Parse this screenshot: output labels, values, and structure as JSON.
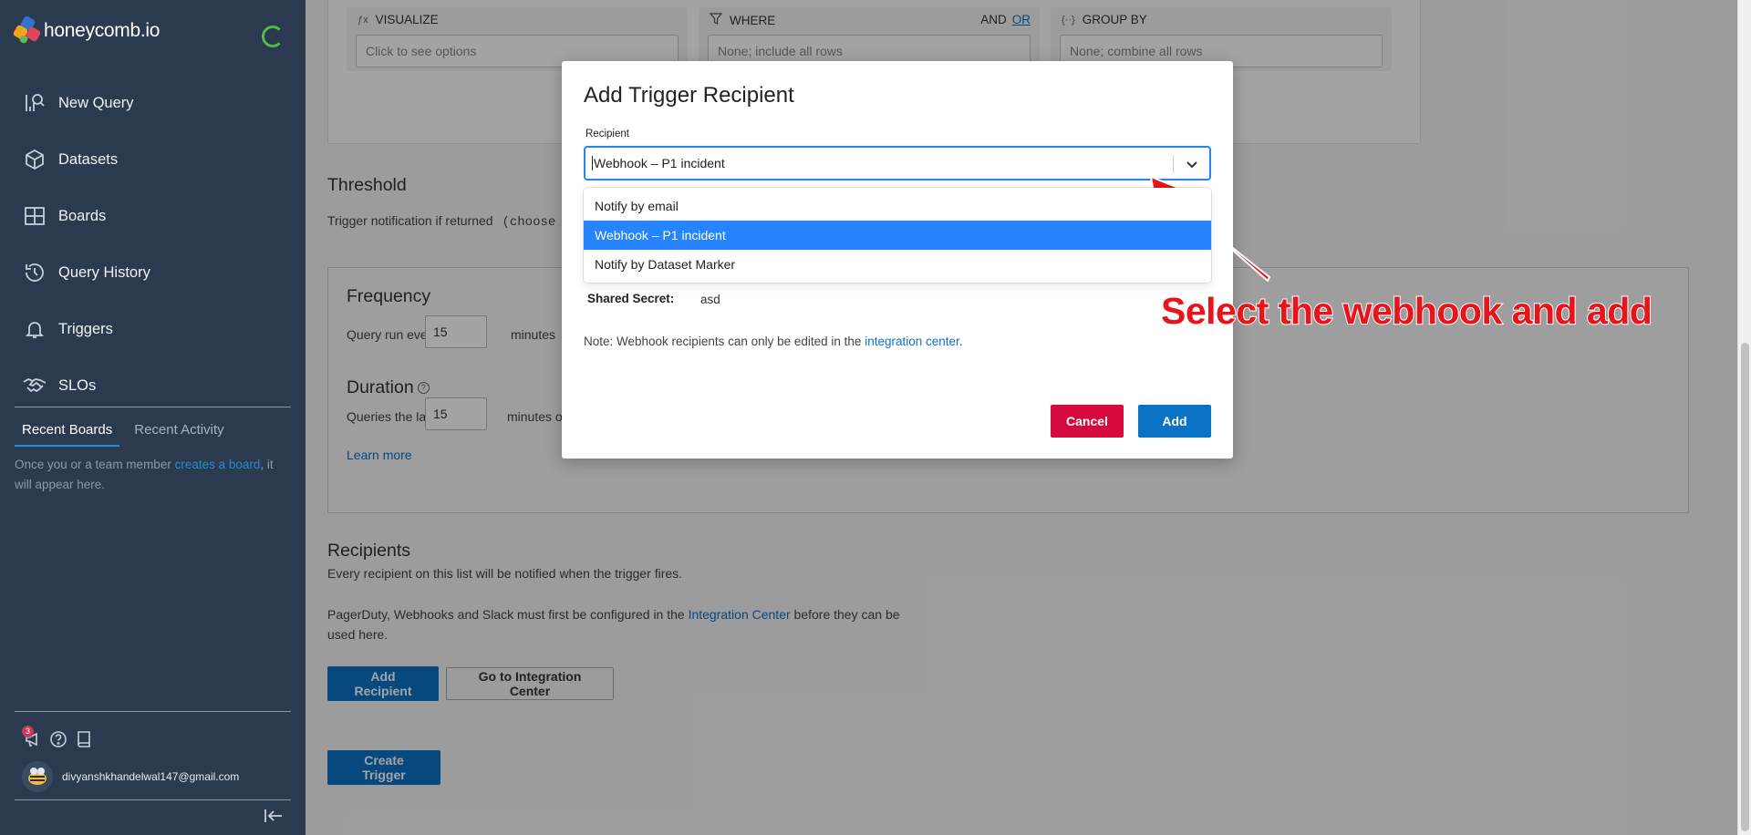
{
  "app": {
    "logo_text": "honeycomb.io"
  },
  "sidebar": {
    "items": [
      {
        "label": "New Query",
        "icon": "new-query-icon"
      },
      {
        "label": "Datasets",
        "icon": "cube-icon"
      },
      {
        "label": "Boards",
        "icon": "boards-icon"
      },
      {
        "label": "Query History",
        "icon": "history-icon"
      },
      {
        "label": "Triggers",
        "icon": "bell-icon"
      },
      {
        "label": "SLOs",
        "icon": "handshake-icon"
      }
    ],
    "tabs": [
      "Recent Boards",
      "Recent Activity"
    ],
    "empty_text_before": "Once you or a team member ",
    "empty_link": "creates a board",
    "empty_text_after": ", it will appear here.",
    "notification_count": "3",
    "user_email": "divyanshkhandelwal147@gmail.com"
  },
  "query": {
    "visualize": {
      "label": "VISUALIZE",
      "placeholder": "Click to see options"
    },
    "where": {
      "label": "WHERE",
      "and": "AND",
      "or": "OR",
      "placeholder": "None; include all rows"
    },
    "group_by": {
      "label": "GROUP BY",
      "placeholder": "None; combine all rows"
    }
  },
  "threshold": {
    "title": "Threshold",
    "text": "Trigger notification if returned",
    "choose": "(choose"
  },
  "frequency": {
    "title": "Frequency",
    "run_label": "Query run every",
    "run_value": "15",
    "run_unit": "minutes"
  },
  "duration": {
    "title": "Duration",
    "label": "Queries the last",
    "value": "15",
    "unit": "minutes of"
  },
  "learn_more": "Learn more",
  "recipients": {
    "title": "Recipients",
    "desc": "Every recipient on this list will be notified when the trigger fires.",
    "integration_text_before": "PagerDuty, Webhooks and Slack must first be configured in the ",
    "integration_link": "Integration Center",
    "integration_text_mid": " before they can be",
    "integration_text_after": "used here.",
    "add_button": "Add Recipient",
    "go_button": "Go to Integration Center"
  },
  "create_button": "Create Trigger",
  "modal": {
    "title": "Add Trigger Recipient",
    "field_label": "Recipient",
    "selected_value": "Webhook – P1 incident",
    "options": [
      "Notify by email",
      "Webhook – P1 incident",
      "Notify by Dataset Marker"
    ],
    "secret_label": "Shared Secret:",
    "secret_value": "asd",
    "note_before": "Note: Webhook recipients can only be edited in the ",
    "note_link": "integration center",
    "note_after": ".",
    "cancel": "Cancel",
    "add": "Add"
  },
  "annotation": {
    "text": "Select the webhook and add",
    "color": "#e8141a"
  },
  "colors": {
    "accent": "#0b72c6",
    "danger": "#d6093f",
    "sidebar": "#2b3a4e",
    "select_focus": "#2684ff"
  }
}
